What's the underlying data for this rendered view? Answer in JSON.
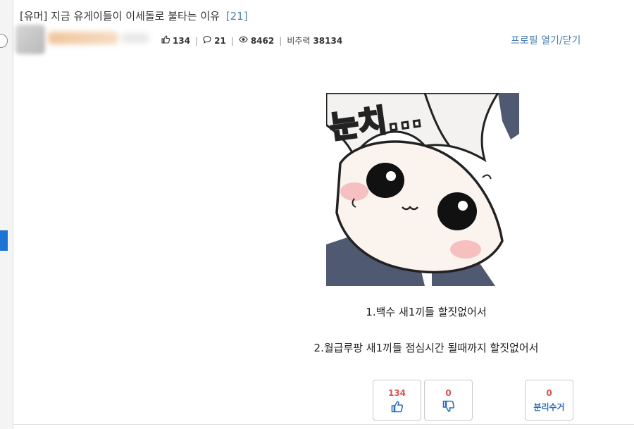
{
  "post": {
    "category": "[유머]",
    "title": "지금 유게이들이 이세돌로 불타는 이유",
    "comment_count": "[21]"
  },
  "stats": {
    "likes": "134",
    "comments": "21",
    "views": "8462",
    "ratio_label": "비추력",
    "ratio_value": "38134"
  },
  "profile_toggle": "프로필 열기/닫기",
  "image": {
    "caption_text": "눈치..."
  },
  "body": {
    "line1": "1.백수 새1끼들 할짓없어서",
    "line2": "2.월급루팡 새1끼들 점심시간 될때까지 할짓없어서"
  },
  "votes": {
    "up": "134",
    "down": "0",
    "report_count": "0",
    "report_label": "분리수거"
  },
  "colors": {
    "link_blue": "#4a7fb5",
    "vote_red": "#d9534f",
    "accent_blue": "#1e74d4"
  },
  "icons": [
    "thumbs-up-icon",
    "speech-bubble-icon",
    "eye-icon",
    "thumbs-down-icon"
  ]
}
